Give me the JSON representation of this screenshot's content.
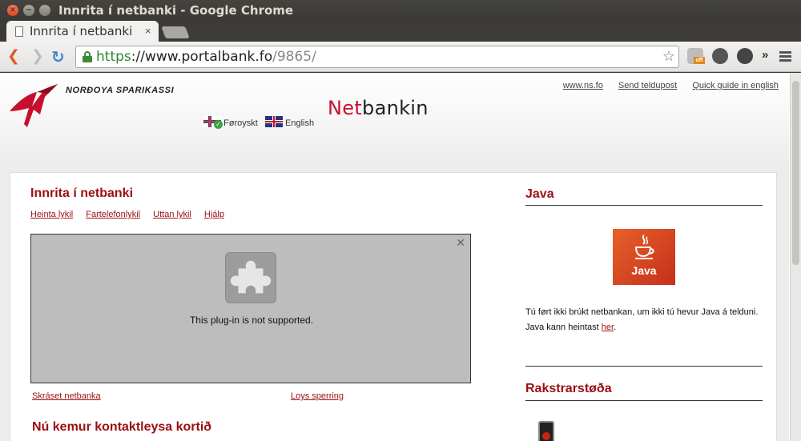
{
  "window": {
    "title": "Innrita í netbanki - Google Chrome"
  },
  "tabs": [
    {
      "label": "Innrita í netbanki",
      "close": "×"
    }
  ],
  "toolbar": {
    "url_scheme": "https",
    "url_host": "://www.portalbank.fo",
    "url_path": "/9865/",
    "extension_badge": "off"
  },
  "header": {
    "bank_name": "NORÐOYA SPARIKASSI",
    "top_links": [
      "www.ns.fo",
      "Send teldupost",
      "Quick guide in english"
    ],
    "brand_net": "Net",
    "brand_bankin": "bankin",
    "languages": [
      "Føroyskt",
      "English"
    ]
  },
  "login": {
    "title": "Innrita í netbanki",
    "sub_links": [
      "Heinta lykil",
      "Fartelefonlykil",
      "Uttan lykil",
      "Hjálp"
    ],
    "plugin_message": "This plug-in is not supported.",
    "plugin_close": "✕",
    "bottom_links": [
      "Skráset netbanka",
      "Loys sperring"
    ],
    "contactless_title": "Nú kemur kontaktleysa kortið"
  },
  "java": {
    "title": "Java",
    "logo_text": "Java",
    "text_1": "Tú ført ikki brúkt netbankan, um ikki tú hevur Java á telduni.",
    "text_2_prefix": "Java kann heintast ",
    "text_2_link": "her",
    "text_2_suffix": "."
  },
  "status": {
    "title": "Rakstrarstøða"
  },
  "colors": {
    "brand_red": "#9b0f14",
    "net_red": "#c8102e",
    "secure_green": "#2b8a2b"
  }
}
